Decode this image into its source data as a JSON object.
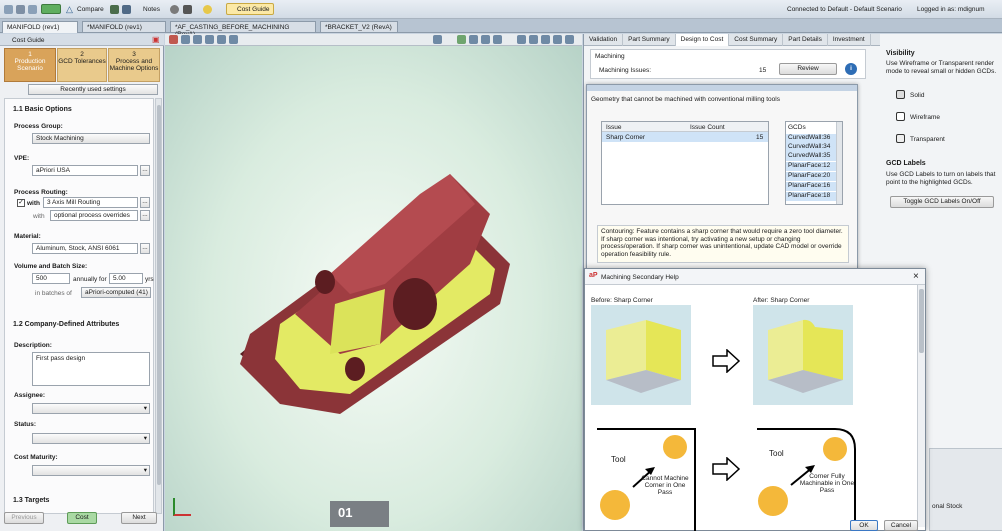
{
  "toolbar": {
    "compare": "Compare",
    "notes": "Notes",
    "cost_guide": "Cost Guide",
    "connected": "Connected to Default - Default Scenario",
    "logged_in": "Logged in as: mdignum"
  },
  "doc_tabs": [
    "MANIFOLD (rev1)",
    "*MANIFOLD (rev1)",
    "*AF_CASTING_BEFORE_MACHINING (RevA)",
    "*BRACKET_V2 (RevA)"
  ],
  "cost_guide": {
    "title": "Cost Guide",
    "steps": [
      {
        "num": "1",
        "label": "Production Scenario"
      },
      {
        "num": "2",
        "label": "GCD Tolerances"
      },
      {
        "num": "3",
        "label": "Process and Machine Options"
      }
    ],
    "recently_used": "Recently used settings",
    "section_basic": "1.1 Basic Options",
    "process_group_label": "Process Group:",
    "process_group_value": "Stock Machining",
    "vpe_label": "VPE:",
    "vpe_value": "aPriori USA",
    "routing_label": "Process Routing:",
    "with1": "with",
    "routing_value": "3 Axis Mill Routing",
    "with2": "with",
    "routing_override": "optional process overrides",
    "material_label": "Material:",
    "material_value": "Aluminum, Stock, ANSI 6061",
    "volume_label": "Volume and Batch Size:",
    "volume_value": "500",
    "annually_for": "annually for",
    "years_value": "5.00",
    "years_unit": "yrs",
    "batches_of": "in batches of",
    "batch_value": "aPriori-computed (41)",
    "section_company": "1.2 Company-Defined Attributes",
    "description_label": "Description:",
    "description_value": "First pass design",
    "assignee_label": "Assignee:",
    "status_label": "Status:",
    "maturity_label": "Cost Maturity:",
    "section_targets": "1.3 Targets",
    "previous": "Previous",
    "cost": "Cost",
    "next": "Next"
  },
  "caption": "01",
  "right_tabs": [
    "Validation",
    "Part Summary",
    "Design to Cost",
    "Cost Summary",
    "Part Details",
    "Investment"
  ],
  "machining": {
    "header": "Machining",
    "issues_label": "Machining Issues:",
    "issues_count": "15",
    "review": "Review"
  },
  "visibility": {
    "title": "Visibility",
    "desc": "Use Wireframe or Transparent render mode to reveal small or hidden GCDs.",
    "solid": "Solid",
    "wireframe": "Wireframe",
    "transparent": "Transparent",
    "gcd_title": "GCD Labels",
    "gcd_desc": "Use GCD Labels to turn on labels that point to the highlighted GCDs.",
    "toggle": "Toggle GCD Labels On/Off",
    "stock": "onal Stock"
  },
  "geometry_dialog": {
    "title": "Geometry that cannot be machined with conventional milling tools",
    "col_issue": "Issue",
    "col_count": "Issue Count",
    "row_issue": "Sharp Corner",
    "row_count": "15",
    "gcd_header": "GCDs",
    "gcds": [
      "CurvedWall:36",
      "CurvedWall:34",
      "CurvedWall:35",
      "PlanarFace:12",
      "PlanarFace:20",
      "PlanarFace:16",
      "PlanarFace:18"
    ],
    "note": "Contouring: Feature contains a sharp corner that would require a zero tool diameter. If sharp corner was intentional, try activating a new setup or changing process/operation. If sharp corner was unintentional, update CAD model or override operation feasibility rule."
  },
  "help_dialog": {
    "title": "Machining Secondary Help",
    "before": "Before: Sharp Corner",
    "after": "After: Sharp Corner",
    "tool1": "Tool",
    "tool2": "Tool",
    "cannot": "Cannot Machine Corner in One Pass",
    "can": "Corner Fully Machinable in One Pass",
    "ok": "OK",
    "cancel": "Cancel"
  }
}
